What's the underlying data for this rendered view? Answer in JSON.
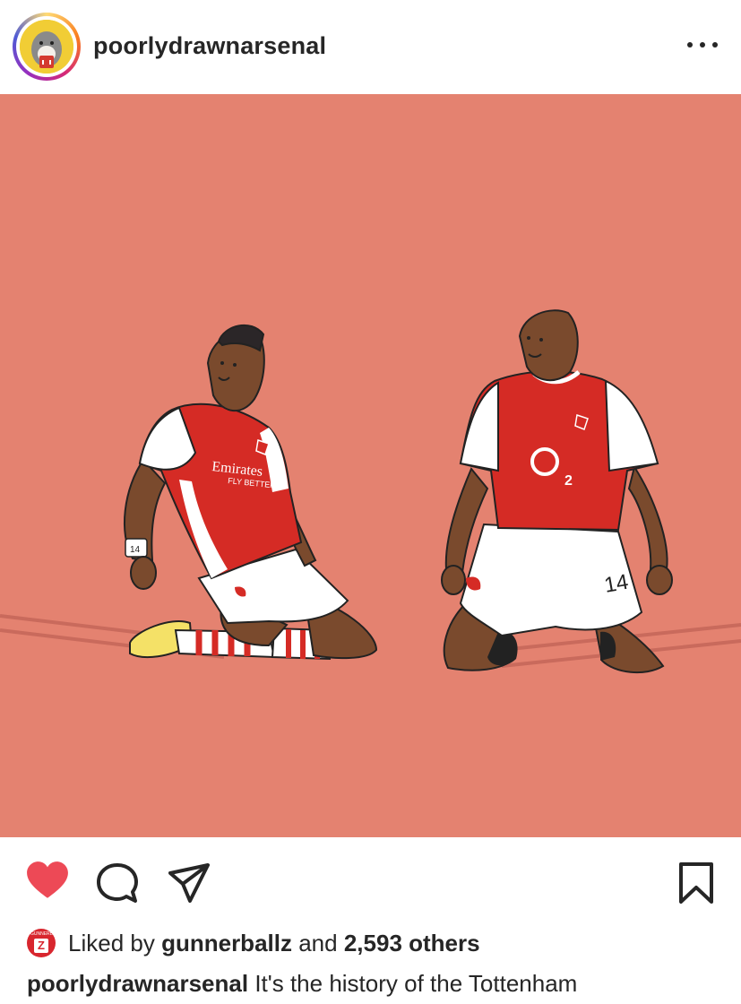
{
  "header": {
    "username": "poorlydrawnarsenal",
    "more_icon": "more-horizontal-icon"
  },
  "post": {
    "image_description_icon": "illustration",
    "jerseys": {
      "left_sponsor_line1": "Emirates",
      "left_sponsor_line2": "FLY BETTER",
      "right_sponsor": "O",
      "right_sponsor_sub": "2",
      "left_wristband": "14",
      "right_number": "14"
    },
    "colors": {
      "background": "#e48270",
      "arsenal_red": "#d52b25",
      "like_red": "#ed4956"
    }
  },
  "actions": {
    "like_icon": "heart-icon",
    "comment_icon": "comment-icon",
    "share_icon": "send-icon",
    "save_icon": "bookmark-icon"
  },
  "likes": {
    "prefix": "Liked by",
    "user": "gunnerballz",
    "conjunction": "and",
    "others": "2,593 others",
    "liker_avatar_letter": "Z",
    "liker_avatar_text": "GUNNERBALLZ"
  },
  "caption": {
    "username": "poorlydrawnarsenal",
    "text": "It's the history of the Tottenham"
  }
}
